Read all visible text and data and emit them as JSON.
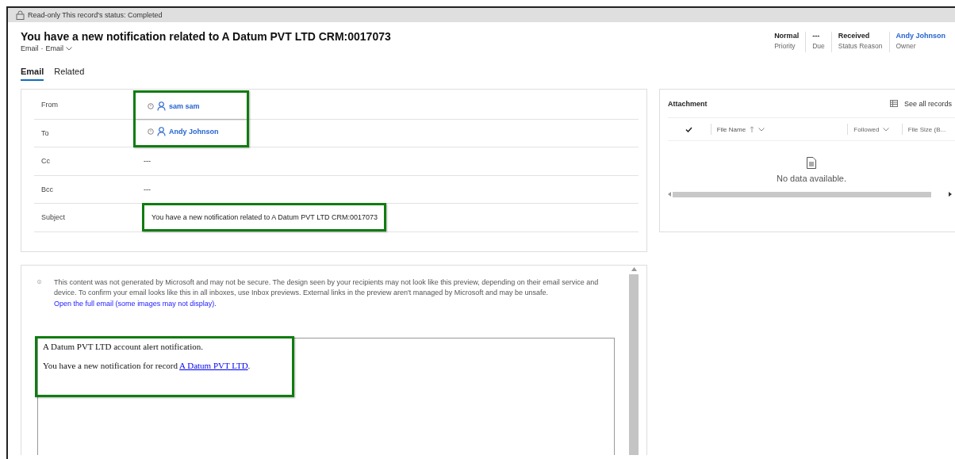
{
  "banner": {
    "text": "Read-only This record's status: Completed"
  },
  "header": {
    "title": "You have a new notification related to A Datum PVT LTD CRM:0017073",
    "entity": "Email",
    "separator": "·",
    "form": "Email",
    "fields": [
      {
        "value": "Normal",
        "label": "Priority",
        "kind": "text"
      },
      {
        "value": "---",
        "label": "Due",
        "kind": "text"
      },
      {
        "value": "Received",
        "label": "Status Reason",
        "kind": "text"
      },
      {
        "value": "Andy Johnson",
        "label": "Owner",
        "kind": "link"
      }
    ]
  },
  "tabs": [
    {
      "label": "Email",
      "selected": true
    },
    {
      "label": "Related",
      "selected": false
    }
  ],
  "fields": [
    {
      "label": "From",
      "kind": "party",
      "value": "sam sam",
      "highlighted": true
    },
    {
      "label": "To",
      "kind": "party",
      "value": "Andy Johnson",
      "highlighted": true
    },
    {
      "label": "Cc",
      "kind": "text",
      "value": "---",
      "highlighted": false
    },
    {
      "label": "Bcc",
      "kind": "text",
      "value": "---",
      "highlighted": false
    },
    {
      "label": "Subject",
      "kind": "text",
      "value": "You have a new notification related to A Datum PVT LTD CRM:0017073",
      "highlighted": true
    }
  ],
  "attachment": {
    "title": "Attachment",
    "see_all": "See all records",
    "columns": [
      {
        "label": "File Name",
        "sorted": true
      },
      {
        "label": "Followed",
        "sorted": false
      },
      {
        "label": "File Size (B...",
        "sorted": false
      }
    ],
    "empty": "No data available."
  },
  "email": {
    "notice": "This content was not generated by Microsoft and may not be secure. The design seen by your recipients may not look like this preview, depending on their email service and device. To confirm your email looks like this in all inboxes, use Inbox previews. External links in the preview aren't managed by Microsoft and may be unsafe.",
    "notice_link": "Open the full email (some images may not display).",
    "highlighted": true,
    "line1": "A Datum PVT LTD account alert notification.",
    "line2": "You have a new notification for record",
    "line2_link": "A Datum PVT LTD",
    "line2_end": "."
  }
}
